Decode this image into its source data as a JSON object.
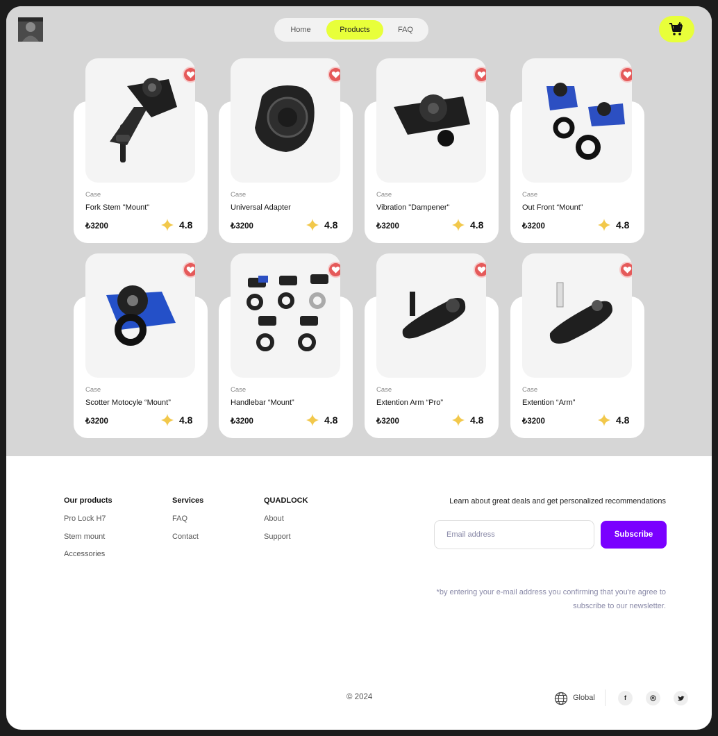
{
  "header": {
    "nav": [
      {
        "label": "Home",
        "active": false
      },
      {
        "label": "Products",
        "active": true
      },
      {
        "label": "FAQ",
        "active": false
      }
    ],
    "cart_icon": "cart-plus-icon",
    "accent": "#e8ff3a"
  },
  "products": [
    {
      "category": "Case",
      "name": "Fork Stem \"Mount\"",
      "price": "₺3200",
      "rating": "4.8",
      "image": "fork-stem-mount"
    },
    {
      "category": "Case",
      "name": "Universal Adapter",
      "price": "₺3200",
      "rating": "4.8",
      "image": "universal-adapter"
    },
    {
      "category": "Case",
      "name": "Vibration \"Dampener\"",
      "price": "₺3200",
      "rating": "4.8",
      "image": "vibration-dampener"
    },
    {
      "category": "Case",
      "name": "Out Front “Mount”",
      "price": "₺3200",
      "rating": "4.8",
      "image": "out-front-mount"
    },
    {
      "category": "Case",
      "name": "Scotter Motocyle “Mount”",
      "price": "₺3200",
      "rating": "4.8",
      "image": "scooter-mount"
    },
    {
      "category": "Case",
      "name": "Handlebar “Mount”",
      "price": "₺3200",
      "rating": "4.8",
      "image": "handlebar-mount"
    },
    {
      "category": "Case",
      "name": "Extention Arm “Pro”",
      "price": "₺3200",
      "rating": "4.8",
      "image": "extension-arm-pro"
    },
    {
      "category": "Case",
      "name": "Extention “Arm”",
      "price": "₺3200",
      "rating": "4.8",
      "image": "extension-arm"
    }
  ],
  "footer": {
    "columns": [
      {
        "title": "Our products",
        "links": [
          "Pro Lock H7",
          "Stem mount",
          "Accessories"
        ]
      },
      {
        "title": "Services",
        "links": [
          "FAQ",
          "Contact"
        ]
      },
      {
        "title": "QUADLOCK",
        "links": [
          "About",
          "Support"
        ]
      }
    ],
    "newsletter": {
      "headline": "Learn about great deals and get personalized recommendations",
      "email_placeholder": "Email address",
      "email_value": "",
      "subscribe_label": "Subscribe",
      "disclaimer_line1": "*by entering your e-mail address you confirming that you're agree to",
      "disclaimer_line2": "subscribe to our newsletter."
    },
    "copyright": "© 2024",
    "region": "Global",
    "social": [
      {
        "icon": "facebook-icon",
        "glyph": "f"
      },
      {
        "icon": "instagram-icon",
        "glyph": "◎"
      },
      {
        "icon": "twitter-icon",
        "glyph": "🐦"
      }
    ],
    "button_color": "#7a00ff"
  }
}
